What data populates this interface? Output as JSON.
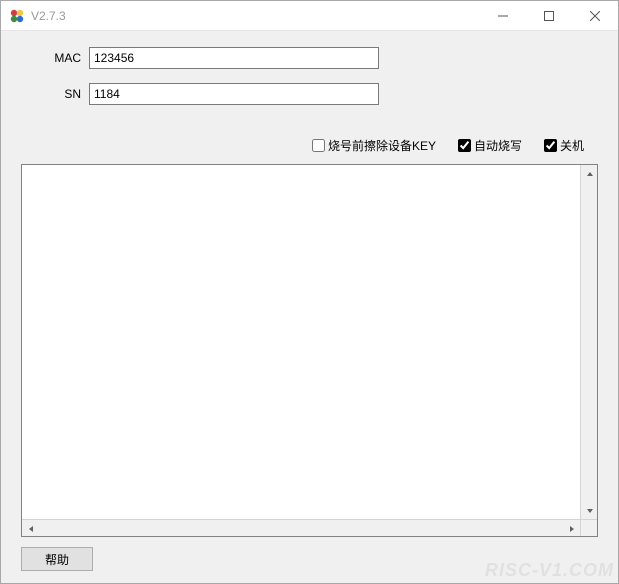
{
  "window": {
    "title": "V2.7.3"
  },
  "form": {
    "mac_label": "MAC",
    "mac_value": "123456",
    "sn_label": "SN",
    "sn_value": "1184"
  },
  "checkboxes": {
    "erase_key": {
      "label": "烧号前擦除设备KEY",
      "checked": false
    },
    "auto_burn": {
      "label": "自动烧写",
      "checked": true
    },
    "shutdown": {
      "label": "关机",
      "checked": true
    }
  },
  "log": {
    "content": ""
  },
  "footer": {
    "help_label": "帮助"
  },
  "watermark": "RISC-V1.COM"
}
